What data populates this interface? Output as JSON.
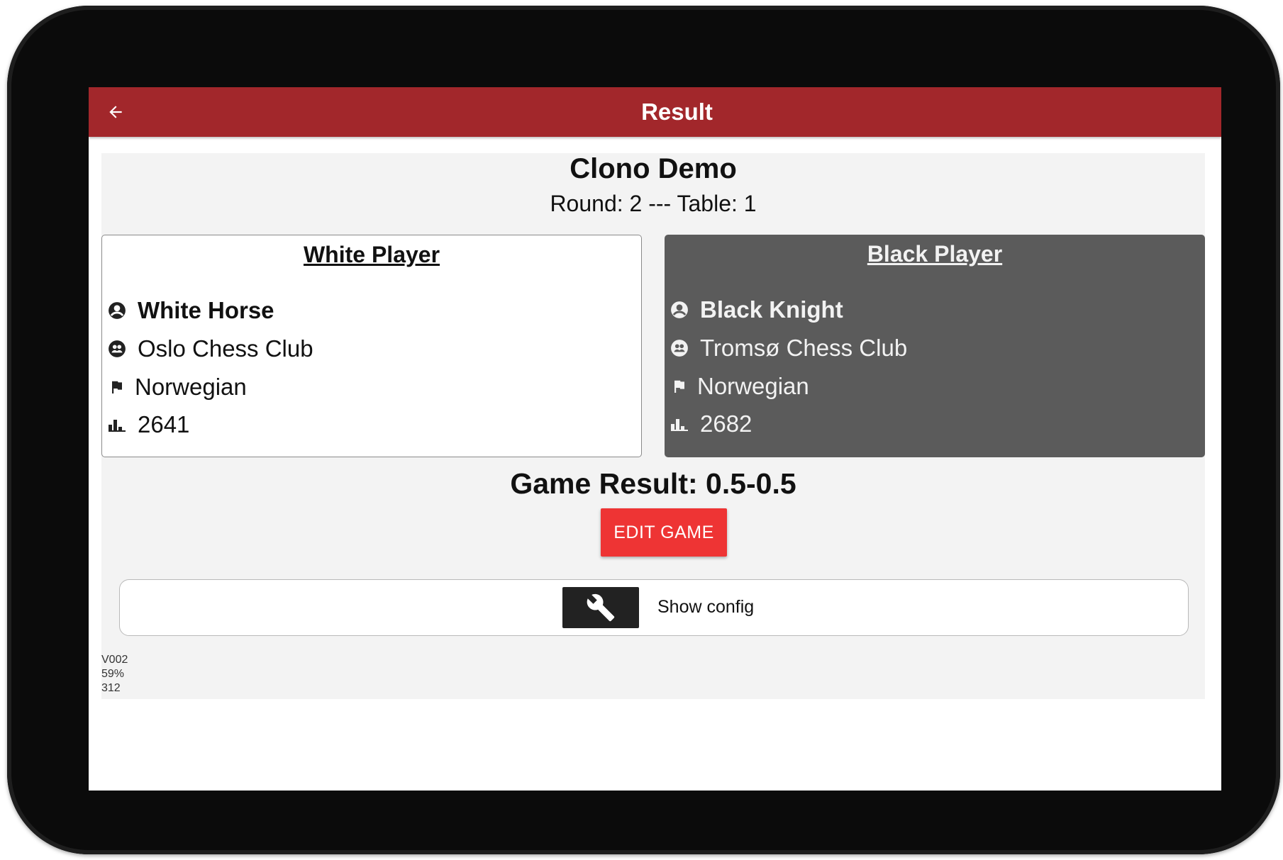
{
  "app_bar": {
    "title": "Result",
    "color": "#a2272b"
  },
  "event": {
    "name": "Clono Demo",
    "round_line": "Round: 2 --- Table: 1"
  },
  "white_player": {
    "heading": "White Player",
    "name": "White Horse",
    "club": "Oslo Chess Club",
    "nationality": "Norwegian",
    "rating": "2641"
  },
  "black_player": {
    "heading": "Black Player",
    "name": "Black Knight",
    "club": "Tromsø Chess Club",
    "nationality": "Norwegian",
    "rating": "2682"
  },
  "game": {
    "result_line": "Game Result: 0.5-0.5",
    "edit_button": "EDIT GAME",
    "edit_button_color": "#ee3434"
  },
  "config": {
    "label": "Show config",
    "icon": "wrench-icon"
  },
  "footer": {
    "version": "V002",
    "percent": "59%",
    "number": "312"
  },
  "icons": {
    "back": "arrow-left-icon",
    "name": "account-circle-icon",
    "club": "group-icon",
    "nationality": "flag-icon",
    "rating": "bar-chart-icon"
  }
}
